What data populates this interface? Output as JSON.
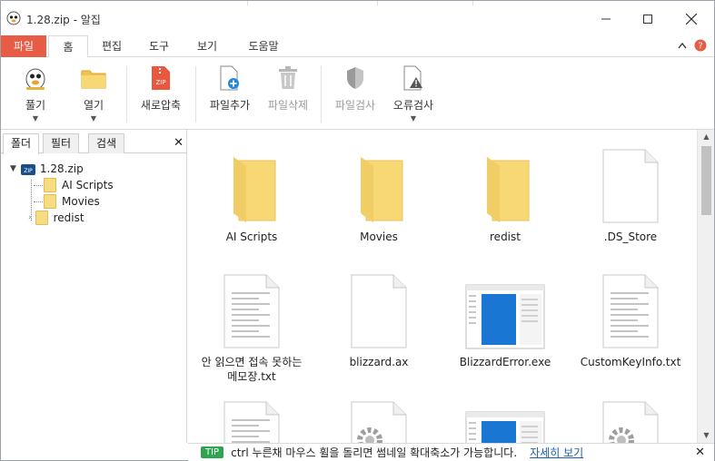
{
  "window": {
    "title": "1.28.zip - 알집"
  },
  "ribbon_tabs": [
    {
      "label": "파일"
    },
    {
      "label": "홈"
    },
    {
      "label": "편집"
    },
    {
      "label": "도구"
    },
    {
      "label": "보기"
    },
    {
      "label": "도움말"
    }
  ],
  "ribbon_buttons": {
    "extract": "풀기",
    "open": "열기",
    "new_archive": "새로압축",
    "add_file": "파일추가",
    "delete_file": "파일삭제",
    "scan_file": "파일검사",
    "error_check": "오류검사"
  },
  "left_tabs": [
    {
      "label": "폴더"
    },
    {
      "label": "필터"
    },
    {
      "label": "검색"
    }
  ],
  "tree": {
    "root": "1.28.zip",
    "children": [
      {
        "label": "AI Scripts"
      },
      {
        "label": "Movies"
      },
      {
        "label": "redist"
      }
    ]
  },
  "files": [
    {
      "name": "AI Scripts",
      "type": "folder"
    },
    {
      "name": "Movies",
      "type": "folder"
    },
    {
      "name": "redist",
      "type": "folder"
    },
    {
      "name": ".DS_Store",
      "type": "blank"
    },
    {
      "name": "안 읽으면 접속 못하는 메모장.txt",
      "type": "text"
    },
    {
      "name": "blizzard.ax",
      "type": "blank"
    },
    {
      "name": "BlizzardError.exe",
      "type": "exe"
    },
    {
      "name": "CustomKeyInfo.txt",
      "type": "text"
    },
    {
      "name": "",
      "type": "text"
    },
    {
      "name": "",
      "type": "gear"
    },
    {
      "name": "",
      "type": "exe"
    },
    {
      "name": "",
      "type": "gear"
    }
  ],
  "tip": {
    "badge": "TIP",
    "text": "ctrl 누른채 마우스 휠을 돌리면 썸네일 확대축소가 가능합니다.",
    "link": "자세히 보기"
  },
  "colors": {
    "file_tab": "#e75c45",
    "tip_badge": "#2fa44f",
    "folder": "#f8dc83",
    "link": "#1a5fb4"
  }
}
